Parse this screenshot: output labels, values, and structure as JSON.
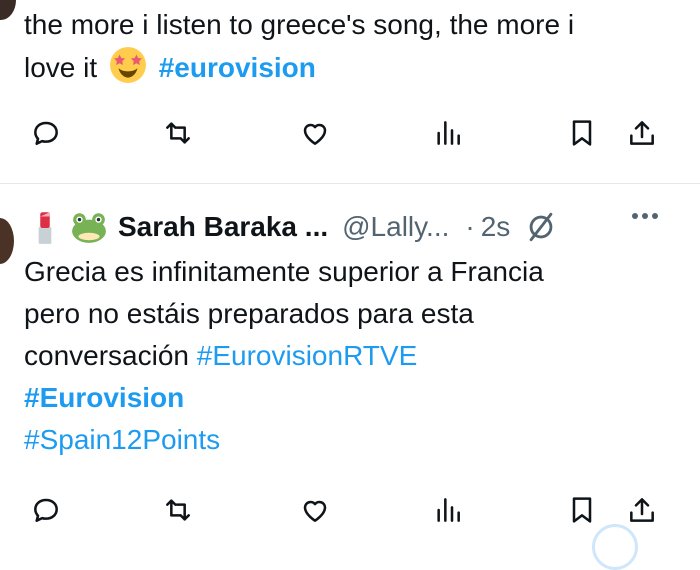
{
  "tweet1": {
    "text": "the more i listen to greece's song, the more i",
    "text2": "love it",
    "emoji": "star-struck",
    "hashtag": "#eurovision"
  },
  "tweet2": {
    "author": {
      "emojis": [
        "lipstick",
        "frog"
      ],
      "display_name": "Sarah Baraka ...",
      "handle": "@Lally...",
      "separator": "·",
      "time": "2s"
    },
    "lines": [
      "Grecia es infinitamente superior a Francia",
      "pero no estáis preparados para esta",
      "conversación"
    ],
    "hashtags": [
      "#EurovisionRTVE",
      "#Eurovision",
      "#Spain12Points"
    ]
  },
  "actions": [
    "reply",
    "retweet",
    "like",
    "views",
    "bookmark",
    "share"
  ],
  "colors": {
    "accent": "#1d9bf0",
    "text": "#0f1419",
    "muted": "#536471",
    "divider": "#e6e9ec"
  }
}
